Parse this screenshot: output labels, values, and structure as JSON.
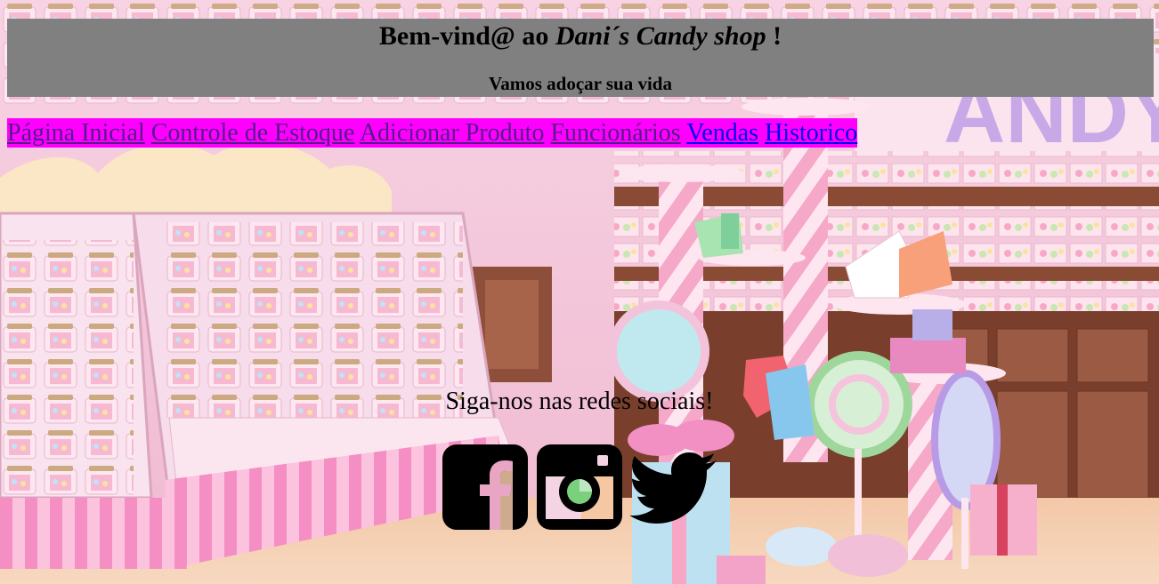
{
  "header": {
    "title_prefix": "Bem-vind@ ao ",
    "title_shop": "Dani´s Candy shop",
    "title_suffix": " !",
    "subtitle": "Vamos adoçar sua vida"
  },
  "nav": {
    "items": [
      {
        "label": "Página Inicial",
        "state": "visited"
      },
      {
        "label": "Controle de Estoque",
        "state": "visited"
      },
      {
        "label": "Adicionar Produto",
        "state": "visited"
      },
      {
        "label": "Funcionários",
        "state": "visited"
      },
      {
        "label": "Vendas",
        "state": "unvisited"
      },
      {
        "label": "Historico",
        "state": "unvisited"
      }
    ],
    "background": "#ff00ff",
    "visited_color": "#551a8b",
    "link_color": "#0000ee"
  },
  "social": {
    "heading": "Siga-nos nas redes sociais!",
    "icons": [
      "facebook-icon",
      "instagram-icon",
      "twitter-icon"
    ]
  },
  "colors": {
    "header_bg": "#808080",
    "scene_pink": "#f3c6d9"
  }
}
